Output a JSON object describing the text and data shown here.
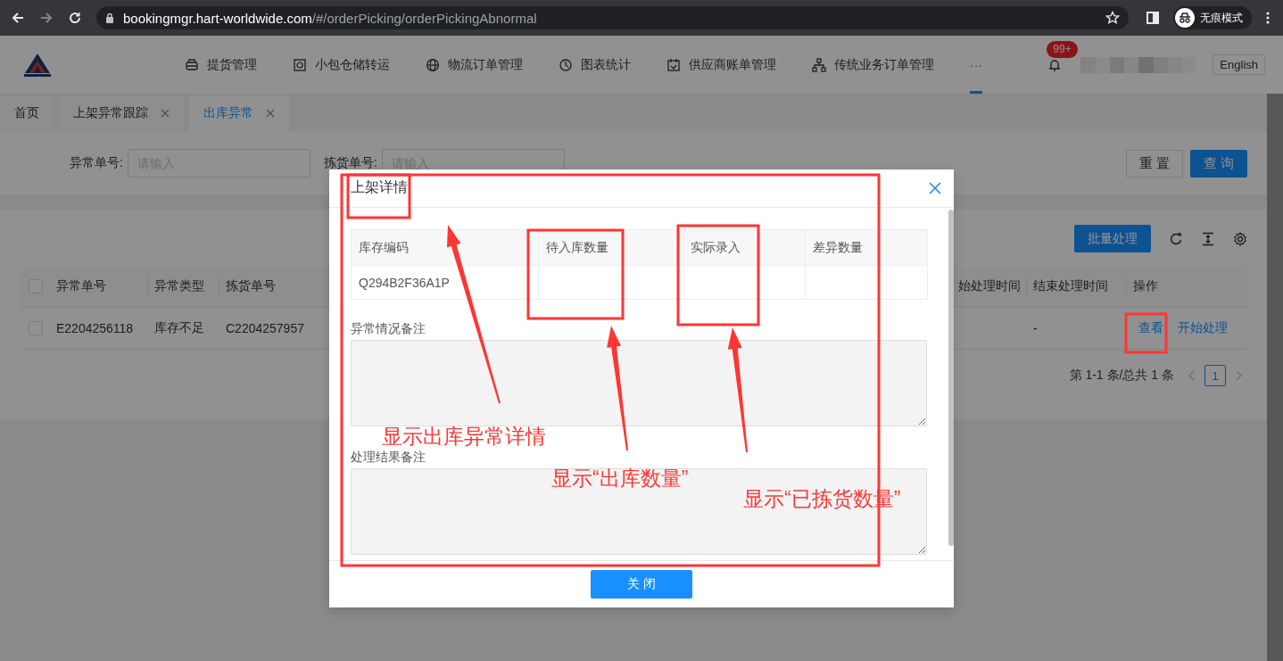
{
  "browser": {
    "url_host": "bookingmgr.hart-worldwide.com",
    "url_path": "/#/orderPicking/orderPickingAbnormal",
    "profile_label": "无痕模式"
  },
  "header": {
    "nav": [
      {
        "label": "提货管理",
        "selected": false
      },
      {
        "label": "小包仓储转运",
        "selected": false
      },
      {
        "label": "物流订单管理",
        "selected": false
      },
      {
        "label": "图表统计",
        "selected": false
      },
      {
        "label": "供应商账单管理",
        "selected": false
      },
      {
        "label": "传统业务订单管理",
        "selected": false
      },
      {
        "label": "···",
        "selected": true
      }
    ],
    "notification_badge": "99+",
    "language_button": "English"
  },
  "tabs": [
    {
      "label": "首页",
      "closable": false,
      "selected": false
    },
    {
      "label": "上架异常跟踪",
      "closable": true,
      "selected": false
    },
    {
      "label": "出库异常",
      "closable": true,
      "selected": true
    }
  ],
  "filters": [
    {
      "label": "异常单号:",
      "placeholder": "请输入"
    },
    {
      "label": "拣货单号:",
      "placeholder": "请输入"
    }
  ],
  "filter_buttons": [
    {
      "label": "重 置",
      "kind": "default"
    },
    {
      "label": "查 询",
      "kind": "primary"
    }
  ],
  "batch_button": "批量处理",
  "table": {
    "header_checked": false,
    "columns": [
      "异常单号",
      "异常类型",
      "拣货单号",
      "始处理时间",
      "结束处理时间",
      "操作"
    ],
    "rows": [
      {
        "checked": false,
        "exception_no": "E2204256118",
        "exception_type": "库存不足",
        "picking_no": "C2204257957",
        "end_time": "-",
        "actions": [
          "查看",
          "开始处理"
        ]
      }
    ]
  },
  "pagination": {
    "summary": "第 1-1 条/总共 1 条",
    "pages": [
      {
        "label": "1",
        "selected": true
      }
    ]
  },
  "modal": {
    "title": "上架详情",
    "columns": [
      "库存编码",
      "待入库数量",
      "实际录入",
      "差异数量"
    ],
    "rows": [
      {
        "stock_code": "Q294B2F36A1P"
      }
    ],
    "remark_fields": [
      {
        "label": "异常情况备注"
      },
      {
        "label": "处理结果备注"
      }
    ],
    "close_button": "关 闭"
  },
  "annotations": [
    {
      "text": "显示出库异常详情"
    },
    {
      "text": "显示“出库数量”"
    },
    {
      "text": "显示“已拣货数量”"
    }
  ]
}
